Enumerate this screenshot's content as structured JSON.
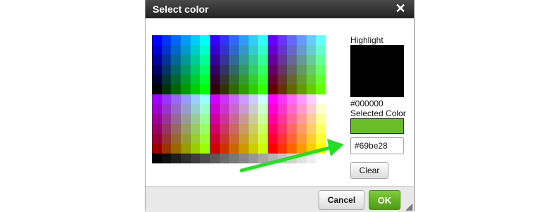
{
  "dialog": {
    "title": "Select color",
    "close_icon": "close-icon"
  },
  "palette": {
    "cols": 18,
    "rows": 12
  },
  "highlight": {
    "label": "Highlight",
    "value": "#000000",
    "color": "#000000"
  },
  "selected": {
    "label": "Selected Color",
    "color": "#69be28",
    "hex_value": "#69be28"
  },
  "buttons": {
    "clear": "Clear",
    "cancel": "Cancel",
    "ok": "OK"
  },
  "colors": {
    "ok_green": "#5fae22",
    "arrow_green": "#22e022",
    "titlebar": "#333333"
  }
}
